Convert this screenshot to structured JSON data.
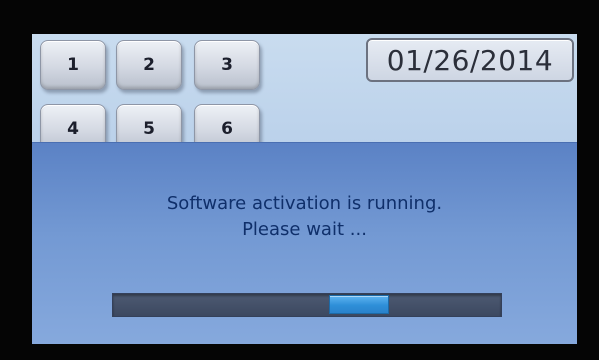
{
  "keypad": {
    "keys": [
      "1",
      "2",
      "3",
      "4",
      "5",
      "6"
    ]
  },
  "date": "01/26/2014",
  "dialog": {
    "message_line1": "Software activation is running.",
    "message_line2": "Please wait ..."
  },
  "progress": {
    "indeterminate": true,
    "chunk_position_fraction": 0.66,
    "track_color": "#46536b",
    "chunk_color": "#3a9be3"
  },
  "colors": {
    "screen_bg": "#c0d5ec",
    "dialog_bg": "#7399d3",
    "message_text": "#0f2f6a"
  }
}
